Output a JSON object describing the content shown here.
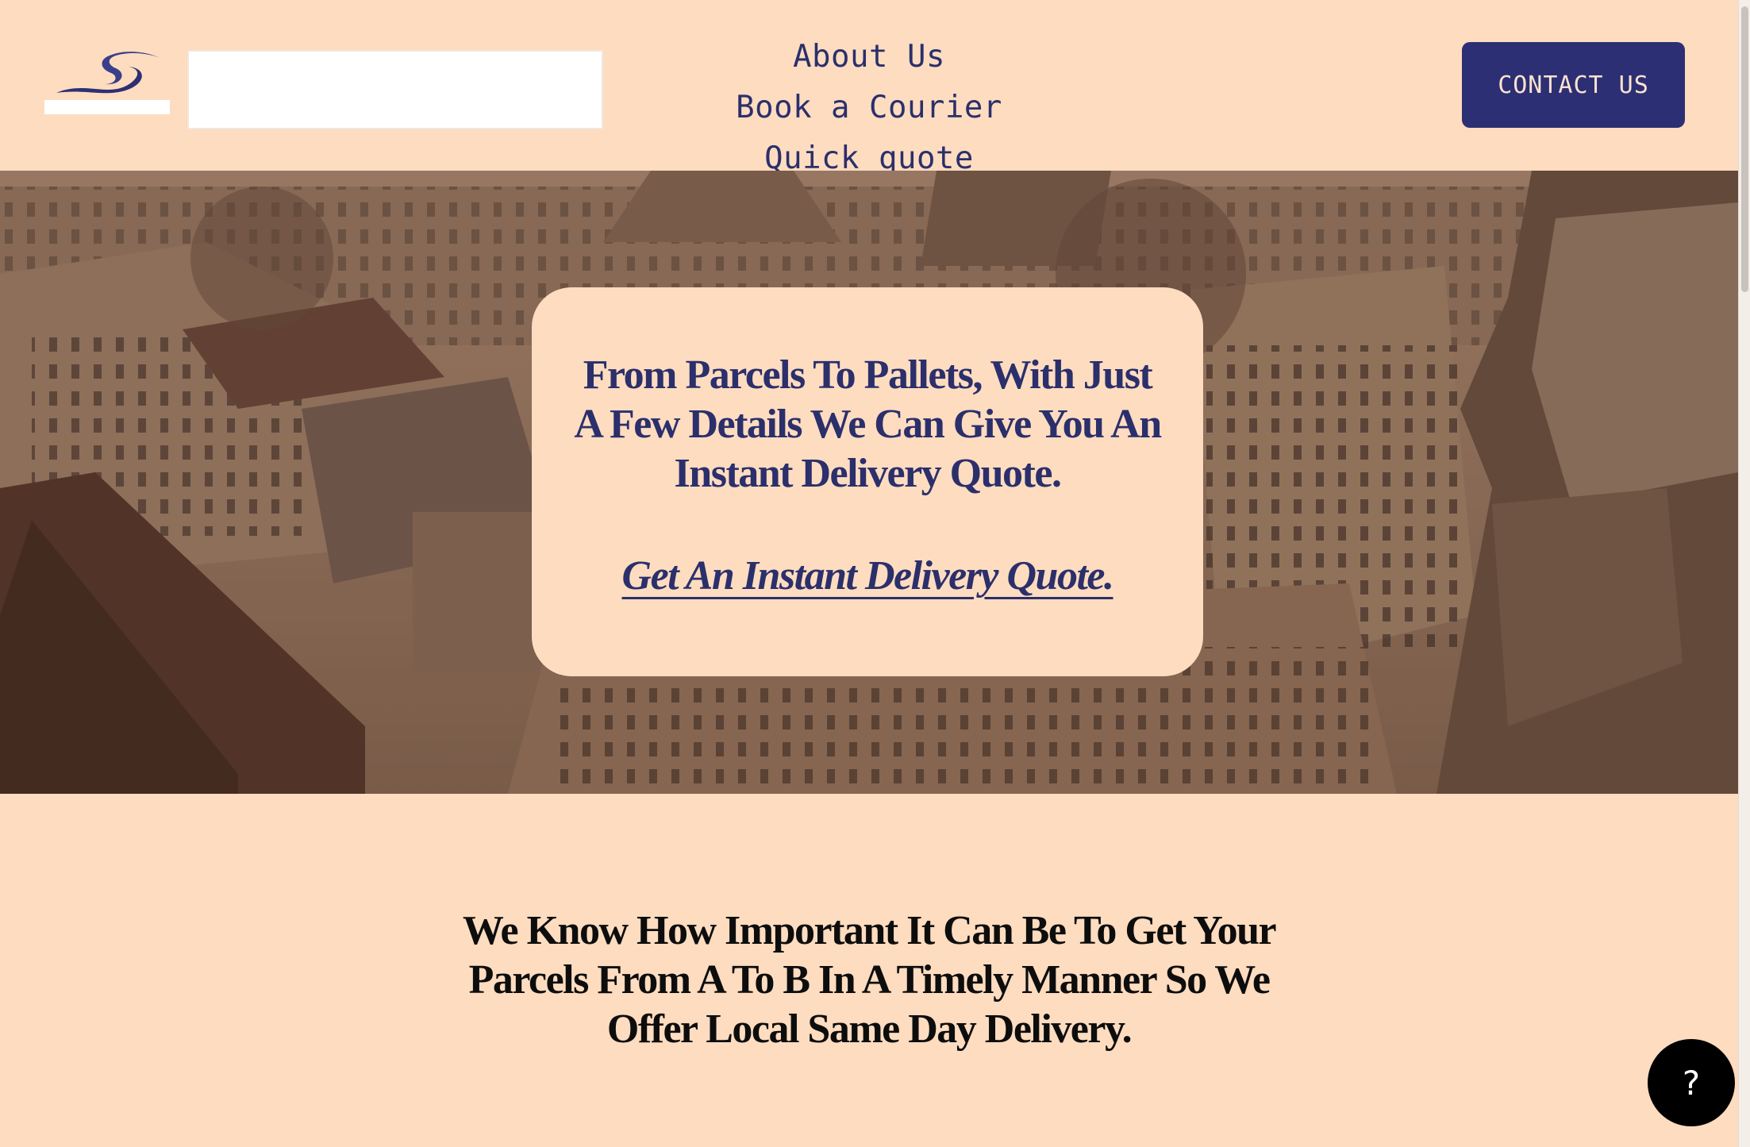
{
  "header": {
    "nav": [
      {
        "label": "About Us"
      },
      {
        "label": "Book a Courier"
      },
      {
        "label": "Quick quote"
      }
    ],
    "contact_label": "CONTACT US"
  },
  "hero": {
    "title": "From Parcels To Pallets, With Just A Few Details We Can Give You An Instant Delivery Quote.",
    "link_label": "Get An Instant Delivery Quote."
  },
  "section": {
    "title": "We Know How Important It Can Be To Get Your Parcels From A To B In A Timely Manner So We Offer Local Same Day Delivery."
  },
  "help": {
    "label": "?"
  },
  "colors": {
    "background": "#fddcc0",
    "accent": "#2c2f73",
    "text_dark": "#0d0d0d"
  },
  "icons": {
    "logo": "swoosh-logo-icon",
    "help": "question-mark-icon"
  }
}
